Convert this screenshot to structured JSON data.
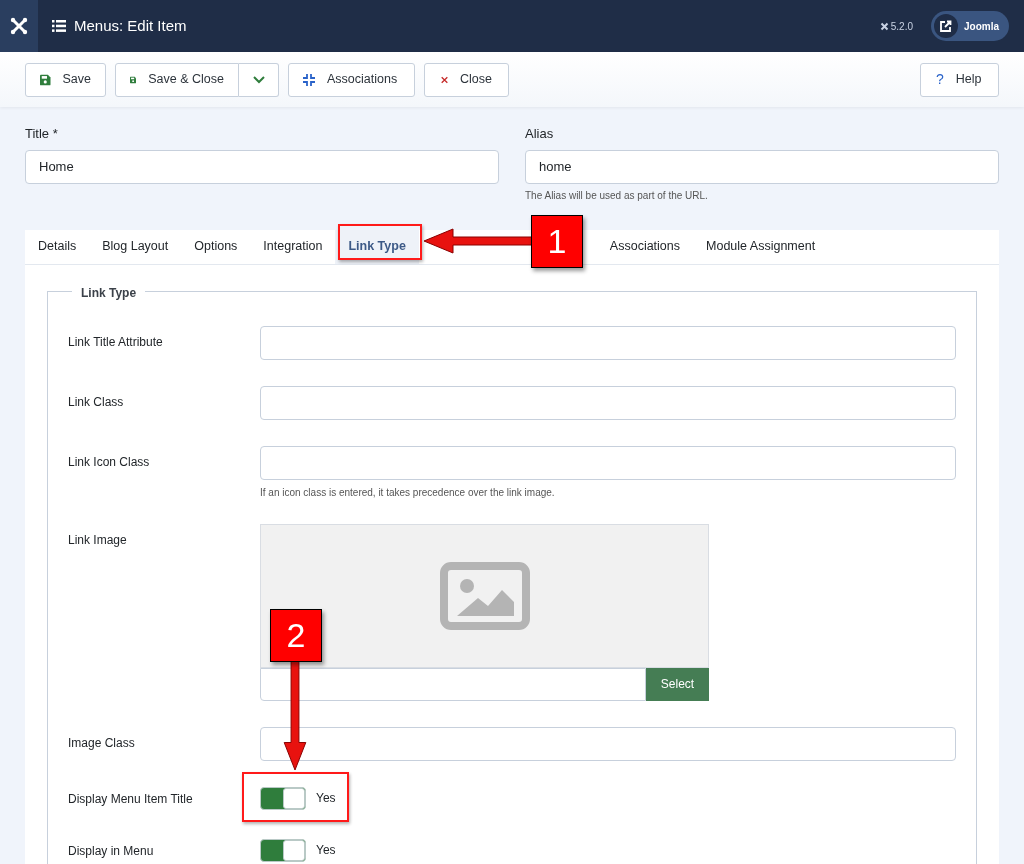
{
  "header": {
    "title": "Menus: Edit Item",
    "version": "5.2.0",
    "site_button": "Joomla"
  },
  "toolbar": {
    "buttons": [
      {
        "label": "Save",
        "kind": "save"
      },
      {
        "label": "Save & Close",
        "kind": "save-split"
      },
      {
        "label": "Associations",
        "kind": "associations"
      },
      {
        "label": "Close",
        "kind": "close"
      }
    ],
    "help": "Help",
    "help_icon": "?"
  },
  "title_field": {
    "label": "Title *",
    "value": "Home"
  },
  "alias_field": {
    "label": "Alias",
    "value": "home",
    "hint": "The Alias will be used as part of the URL."
  },
  "tabs": [
    {
      "label": "Details",
      "selected": false
    },
    {
      "label": "Blog Layout",
      "selected": false
    },
    {
      "label": "Options",
      "selected": false
    },
    {
      "label": "Integration",
      "selected": false
    },
    {
      "label": "Link Type",
      "selected": true
    },
    {
      "kind": "covered"
    },
    {
      "label": "Associations",
      "selected": false
    },
    {
      "label": "Module Assignment",
      "selected": false
    }
  ],
  "fieldset": {
    "legend": "Link Type",
    "fields": [
      {
        "kind": "text",
        "label": "Link Title Attribute"
      },
      {
        "kind": "text",
        "label": "Link Class"
      },
      {
        "kind": "text",
        "label": "Link Icon Class",
        "hint": "If an icon class is entered, it takes precedence over the link image."
      },
      {
        "kind": "image",
        "label": "Link Image",
        "button": "Select"
      },
      {
        "kind": "text",
        "label": "Image Class"
      },
      {
        "kind": "toggle",
        "label": "Display Menu Item Title",
        "on": true,
        "value": "Yes"
      },
      {
        "kind": "toggle",
        "label": "Display in Menu",
        "on": true,
        "value": "Yes"
      }
    ]
  },
  "callouts": [
    {
      "label": "1"
    },
    {
      "label": "2"
    }
  ]
}
